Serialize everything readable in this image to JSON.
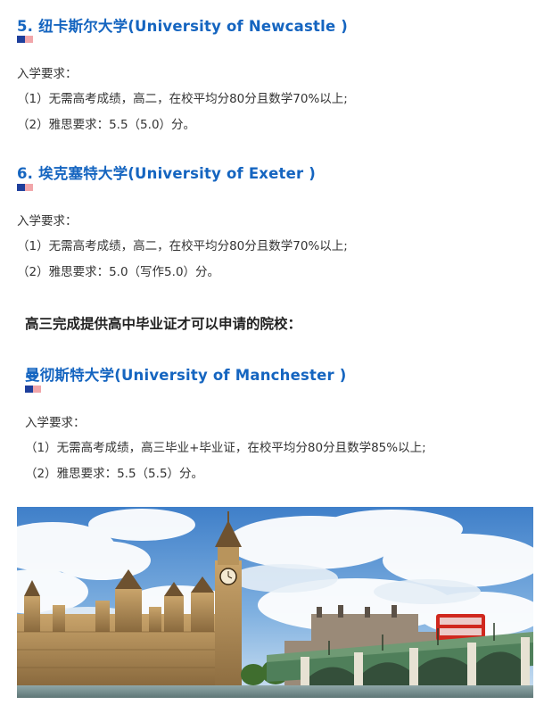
{
  "sections": [
    {
      "title": "5. 纽卡斯尔大学(University of Newcastle )",
      "req_label": "入学要求：",
      "req1": "（1）无需高考成绩，高二，在校平均分80分且数学70%以上;",
      "req2": "（2）雅思要求：5.5（5.0）分。"
    },
    {
      "title": "6. 埃克塞特大学(University of Exeter )",
      "req_label": "入学要求：",
      "req1": "（1）无需高考成绩，高二，在校平均分80分且数学70%以上;",
      "req2": "（2）雅思要求：5.0（写作5.0）分。"
    },
    {
      "title": "曼彻斯特大学(University of Manchester )",
      "req_label": "入学要求：",
      "req1": "（1）无需高考成绩，高三毕业+毕业证，在校平均分80分且数学85%以上;",
      "req2": "（2）雅思要求：5.5（5.5）分。"
    }
  ],
  "group_heading": "高三完成提供高中毕业证才可以申请的院校：",
  "colors": {
    "heading_blue": "#1565c0",
    "deco_blue": "#1e3f9c",
    "deco_pink": "#f1a6aa",
    "body_text": "#333333"
  }
}
